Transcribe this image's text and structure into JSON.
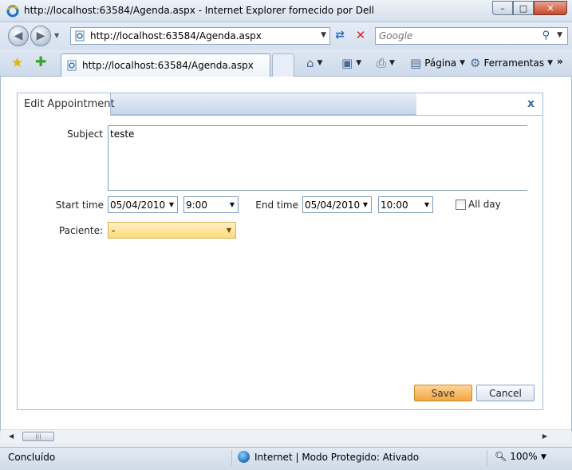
{
  "window": {
    "title": "http://localhost:63584/Agenda.aspx - Internet Explorer fornecido por Dell",
    "minimize": "–",
    "maximize": "□",
    "close": "✕"
  },
  "address_bar": {
    "url": "http://localhost:63584/Agenda.aspx",
    "search_placeholder": "Google"
  },
  "tab": {
    "label": "http://localhost:63584/Agenda.aspx"
  },
  "command_bar": {
    "page_label": "Página",
    "tools_label": "Ferramentas",
    "more": "»"
  },
  "dialog": {
    "title": "Edit Appointment",
    "close": "x",
    "subject_label": "Subject",
    "subject_value": "teste",
    "start_time_label": "Start time",
    "start_date": "05/04/2010",
    "start_time": "9:00",
    "end_time_label": "End time",
    "end_date": "05/04/2010",
    "end_time": "10:00",
    "all_day_label": "All day",
    "all_day_checked": false,
    "paciente_label": "Paciente:",
    "paciente_value": "-",
    "save_label": "Save",
    "cancel_label": "Cancel"
  },
  "status_bar": {
    "status": "Concluído",
    "zone": "Internet | Modo Protegido: Ativado",
    "zoom": "100%"
  },
  "icons": [
    "ie-logo-icon",
    "back-arrow-icon",
    "forward-arrow-icon",
    "page-icon",
    "refresh-icon",
    "stop-icon",
    "search-icon",
    "favorites-star-icon",
    "add-favorites-icon",
    "home-icon",
    "feeds-icon",
    "print-icon",
    "page-menu-icon",
    "tools-gear-icon",
    "globe-icon",
    "zoom-icon",
    "dialog-close-icon"
  ]
}
